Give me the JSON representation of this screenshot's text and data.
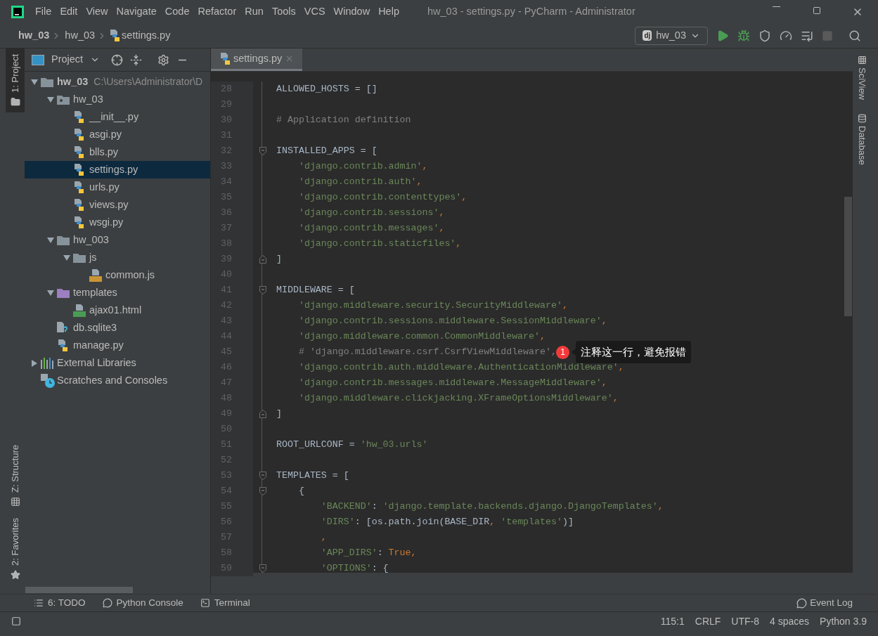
{
  "window": {
    "title": "hw_03 - settings.py - PyCharm - Administrator"
  },
  "menu": [
    "File",
    "Edit",
    "View",
    "Navigate",
    "Code",
    "Refactor",
    "Run",
    "Tools",
    "VCS",
    "Window",
    "Help"
  ],
  "breadcrumbs": [
    "hw_03",
    "hw_03",
    "settings.py"
  ],
  "run_config": {
    "badge": "dj",
    "label": "hw_03"
  },
  "left_stripe": [
    {
      "label": "1: Project",
      "selected": true
    },
    {
      "label": "Z: Structure",
      "selected": false
    },
    {
      "label": "2: Favorites",
      "selected": false
    }
  ],
  "right_stripe": [
    {
      "label": "SciView"
    },
    {
      "label": "Database"
    }
  ],
  "project_panel": {
    "title": "Project"
  },
  "tree": [
    {
      "name": "hw_03",
      "kind": "folder",
      "bold": true,
      "path": "C:\\Users\\Administrator\\D",
      "expanded": true,
      "selected": false,
      "children": [
        {
          "name": "hw_03",
          "kind": "package",
          "expanded": true,
          "selected": false,
          "children": [
            {
              "name": "__init__.py",
              "kind": "python",
              "selected": false
            },
            {
              "name": "asgi.py",
              "kind": "python",
              "selected": false
            },
            {
              "name": "blls.py",
              "kind": "python",
              "selected": false
            },
            {
              "name": "settings.py",
              "kind": "python",
              "selected": true
            },
            {
              "name": "urls.py",
              "kind": "python",
              "selected": false
            },
            {
              "name": "views.py",
              "kind": "python",
              "selected": false
            },
            {
              "name": "wsgi.py",
              "kind": "python",
              "selected": false
            }
          ]
        },
        {
          "name": "hw_003",
          "kind": "folder",
          "expanded": true,
          "selected": false,
          "children": [
            {
              "name": "js",
              "kind": "folder",
              "expanded": true,
              "selected": false,
              "children": [
                {
                  "name": "common.js",
                  "kind": "js",
                  "selected": false
                }
              ]
            }
          ]
        },
        {
          "name": "templates",
          "kind": "templates",
          "expanded": true,
          "selected": false,
          "children": [
            {
              "name": "ajax01.html",
              "kind": "html",
              "selected": false
            }
          ]
        },
        {
          "name": "db.sqlite3",
          "kind": "unknown",
          "selected": false
        },
        {
          "name": "manage.py",
          "kind": "python",
          "selected": false
        }
      ]
    },
    {
      "name": "External Libraries",
      "kind": "libraries",
      "expanded": false,
      "selected": false
    },
    {
      "name": "Scratches and Consoles",
      "kind": "scratches",
      "selected": false
    }
  ],
  "editor_tabs": [
    {
      "label": "settings.py",
      "selected": true
    }
  ],
  "code": [
    {
      "n": "28",
      "tokens": [
        {
          "kind": "plain",
          "text": "ALLOWED_HOSTS = []"
        }
      ]
    },
    {
      "n": "29"
    },
    {
      "n": "30",
      "tokens": [
        {
          "kind": "comment",
          "text": "# Application definition"
        }
      ]
    },
    {
      "n": "31"
    },
    {
      "n": "32",
      "fold_start": true,
      "tokens": [
        {
          "kind": "plain",
          "text": "INSTALLED_APPS = ["
        }
      ]
    },
    {
      "n": "33",
      "tokens": [
        {
          "kind": "string",
          "text": "    'django.contrib.admin'"
        },
        {
          "kind": "punct",
          "text": ","
        }
      ]
    },
    {
      "n": "34",
      "tokens": [
        {
          "kind": "string",
          "text": "    'django.contrib.auth'"
        },
        {
          "kind": "punct",
          "text": ","
        }
      ]
    },
    {
      "n": "35",
      "tokens": [
        {
          "kind": "string",
          "text": "    'django.contrib.contenttypes'"
        },
        {
          "kind": "punct",
          "text": ","
        }
      ]
    },
    {
      "n": "36",
      "tokens": [
        {
          "kind": "string",
          "text": "    'django.contrib.sessions'"
        },
        {
          "kind": "punct",
          "text": ","
        }
      ]
    },
    {
      "n": "37",
      "tokens": [
        {
          "kind": "string",
          "text": "    'django.contrib.messages'"
        },
        {
          "kind": "punct",
          "text": ","
        }
      ]
    },
    {
      "n": "38",
      "tokens": [
        {
          "kind": "string",
          "text": "    'django.contrib.staticfiles'"
        },
        {
          "kind": "punct",
          "text": ","
        }
      ]
    },
    {
      "n": "39",
      "fold_end": true,
      "tokens": [
        {
          "kind": "plain",
          "text": "]"
        }
      ]
    },
    {
      "n": "40"
    },
    {
      "n": "41",
      "fold_start": true,
      "tokens": [
        {
          "kind": "plain",
          "text": "MIDDLEWARE = ["
        }
      ]
    },
    {
      "n": "42",
      "tokens": [
        {
          "kind": "string",
          "text": "    'django.middleware.security.SecurityMiddleware'"
        },
        {
          "kind": "punct",
          "text": ","
        }
      ]
    },
    {
      "n": "43",
      "tokens": [
        {
          "kind": "string",
          "text": "    'django.contrib.sessions.middleware.SessionMiddleware'"
        },
        {
          "kind": "punct",
          "text": ","
        }
      ]
    },
    {
      "n": "44",
      "tokens": [
        {
          "kind": "string",
          "text": "    'django.middleware.common.CommonMiddleware'"
        },
        {
          "kind": "punct",
          "text": ","
        }
      ]
    },
    {
      "n": "45",
      "tokens": [
        {
          "kind": "comment",
          "text": "    # 'django.middleware.csrf.CsrfViewMiddleware',"
        }
      ],
      "annotation": {
        "badge": "1",
        "text": "注释这一行，避免报错"
      }
    },
    {
      "n": "46",
      "tokens": [
        {
          "kind": "string",
          "text": "    'django.contrib.auth.middleware.AuthenticationMiddleware'"
        },
        {
          "kind": "punct",
          "text": ","
        }
      ]
    },
    {
      "n": "47",
      "tokens": [
        {
          "kind": "string",
          "text": "    'django.contrib.messages.middleware.MessageMiddleware'"
        },
        {
          "kind": "punct",
          "text": ","
        }
      ]
    },
    {
      "n": "48",
      "tokens": [
        {
          "kind": "string",
          "text": "    'django.middleware.clickjacking.XFrameOptionsMiddleware'"
        },
        {
          "kind": "punct",
          "text": ","
        }
      ]
    },
    {
      "n": "49",
      "fold_end": true,
      "tokens": [
        {
          "kind": "plain",
          "text": "]"
        }
      ]
    },
    {
      "n": "50"
    },
    {
      "n": "51",
      "tokens": [
        {
          "kind": "plain",
          "text": "ROOT_URLCONF = "
        },
        {
          "kind": "string",
          "text": "'hw_03.urls'"
        }
      ]
    },
    {
      "n": "52"
    },
    {
      "n": "53",
      "fold_start": true,
      "tokens": [
        {
          "kind": "plain",
          "text": "TEMPLATES = ["
        }
      ]
    },
    {
      "n": "54",
      "fold_start": true,
      "tokens": [
        {
          "kind": "plain",
          "text": "    {"
        }
      ]
    },
    {
      "n": "55",
      "tokens": [
        {
          "kind": "string",
          "text": "        'BACKEND'"
        },
        {
          "kind": "plain",
          "text": ": "
        },
        {
          "kind": "string",
          "text": "'django.template.backends.django.DjangoTemplates'"
        },
        {
          "kind": "punct",
          "text": ","
        }
      ]
    },
    {
      "n": "56",
      "tokens": [
        {
          "kind": "string",
          "text": "        'DIRS'"
        },
        {
          "kind": "plain",
          "text": ": [os.path.join(BASE_DIR"
        },
        {
          "kind": "punct",
          "text": ","
        },
        {
          "kind": "string",
          "text": " 'templates'"
        },
        {
          "kind": "plain",
          "text": ")]"
        }
      ]
    },
    {
      "n": "57",
      "tokens": [
        {
          "kind": "punct",
          "text": "        ,"
        }
      ]
    },
    {
      "n": "58",
      "tokens": [
        {
          "kind": "string",
          "text": "        'APP_DIRS'"
        },
        {
          "kind": "plain",
          "text": ": "
        },
        {
          "kind": "keyword",
          "text": "True"
        },
        {
          "kind": "punct",
          "text": ","
        }
      ]
    },
    {
      "n": "59",
      "fold_start": true,
      "tokens": [
        {
          "kind": "string",
          "text": "        'OPTIONS'"
        },
        {
          "kind": "plain",
          "text": ": {"
        }
      ]
    }
  ],
  "tool_windows": [
    {
      "kind": "todo",
      "label": "6: TODO"
    },
    {
      "kind": "console",
      "label": "Python Console"
    },
    {
      "kind": "terminal",
      "label": "Terminal"
    }
  ],
  "event_log": "Event Log",
  "status_bar": [
    "115:1",
    "CRLF",
    "UTF-8",
    "4 spaces",
    "Python 3.9"
  ]
}
